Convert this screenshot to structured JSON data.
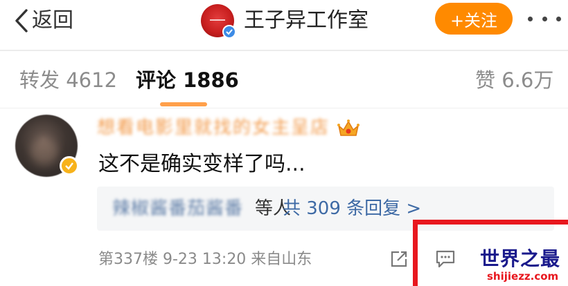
{
  "header": {
    "back_label": "返回",
    "title": "王子异工作室",
    "follow_label": "+关注"
  },
  "tabs": {
    "repost": "转发 4612",
    "comment": "评论 1886",
    "like": "赞 6.6万"
  },
  "comment": {
    "username": "想看电影里就找的女主呈店",
    "text": "这不是确实变样了吗...",
    "reply_names": "辣椒酱番茄酱番",
    "reply_people": "等人",
    "reply_count": "共 309 条回复 >",
    "meta": "第337楼 9-23 13:20 来自山东"
  },
  "watermark": {
    "title": "世界之最",
    "subtitle": "shijiezz.com"
  },
  "colors": {
    "accent": "#ff8a00",
    "tab_indicator": "#ffa04a",
    "link": "#3e6aa5",
    "annotation": "#e8171e",
    "verified": "#3c8be6",
    "vip_badge": "#f7b21b"
  },
  "icons": {
    "back": "chevron-left-icon",
    "verified": "verified-check-icon",
    "more": "more-dots-icon",
    "crown": "crown-icon",
    "share": "share-icon",
    "reply": "reply-comment-icon"
  }
}
